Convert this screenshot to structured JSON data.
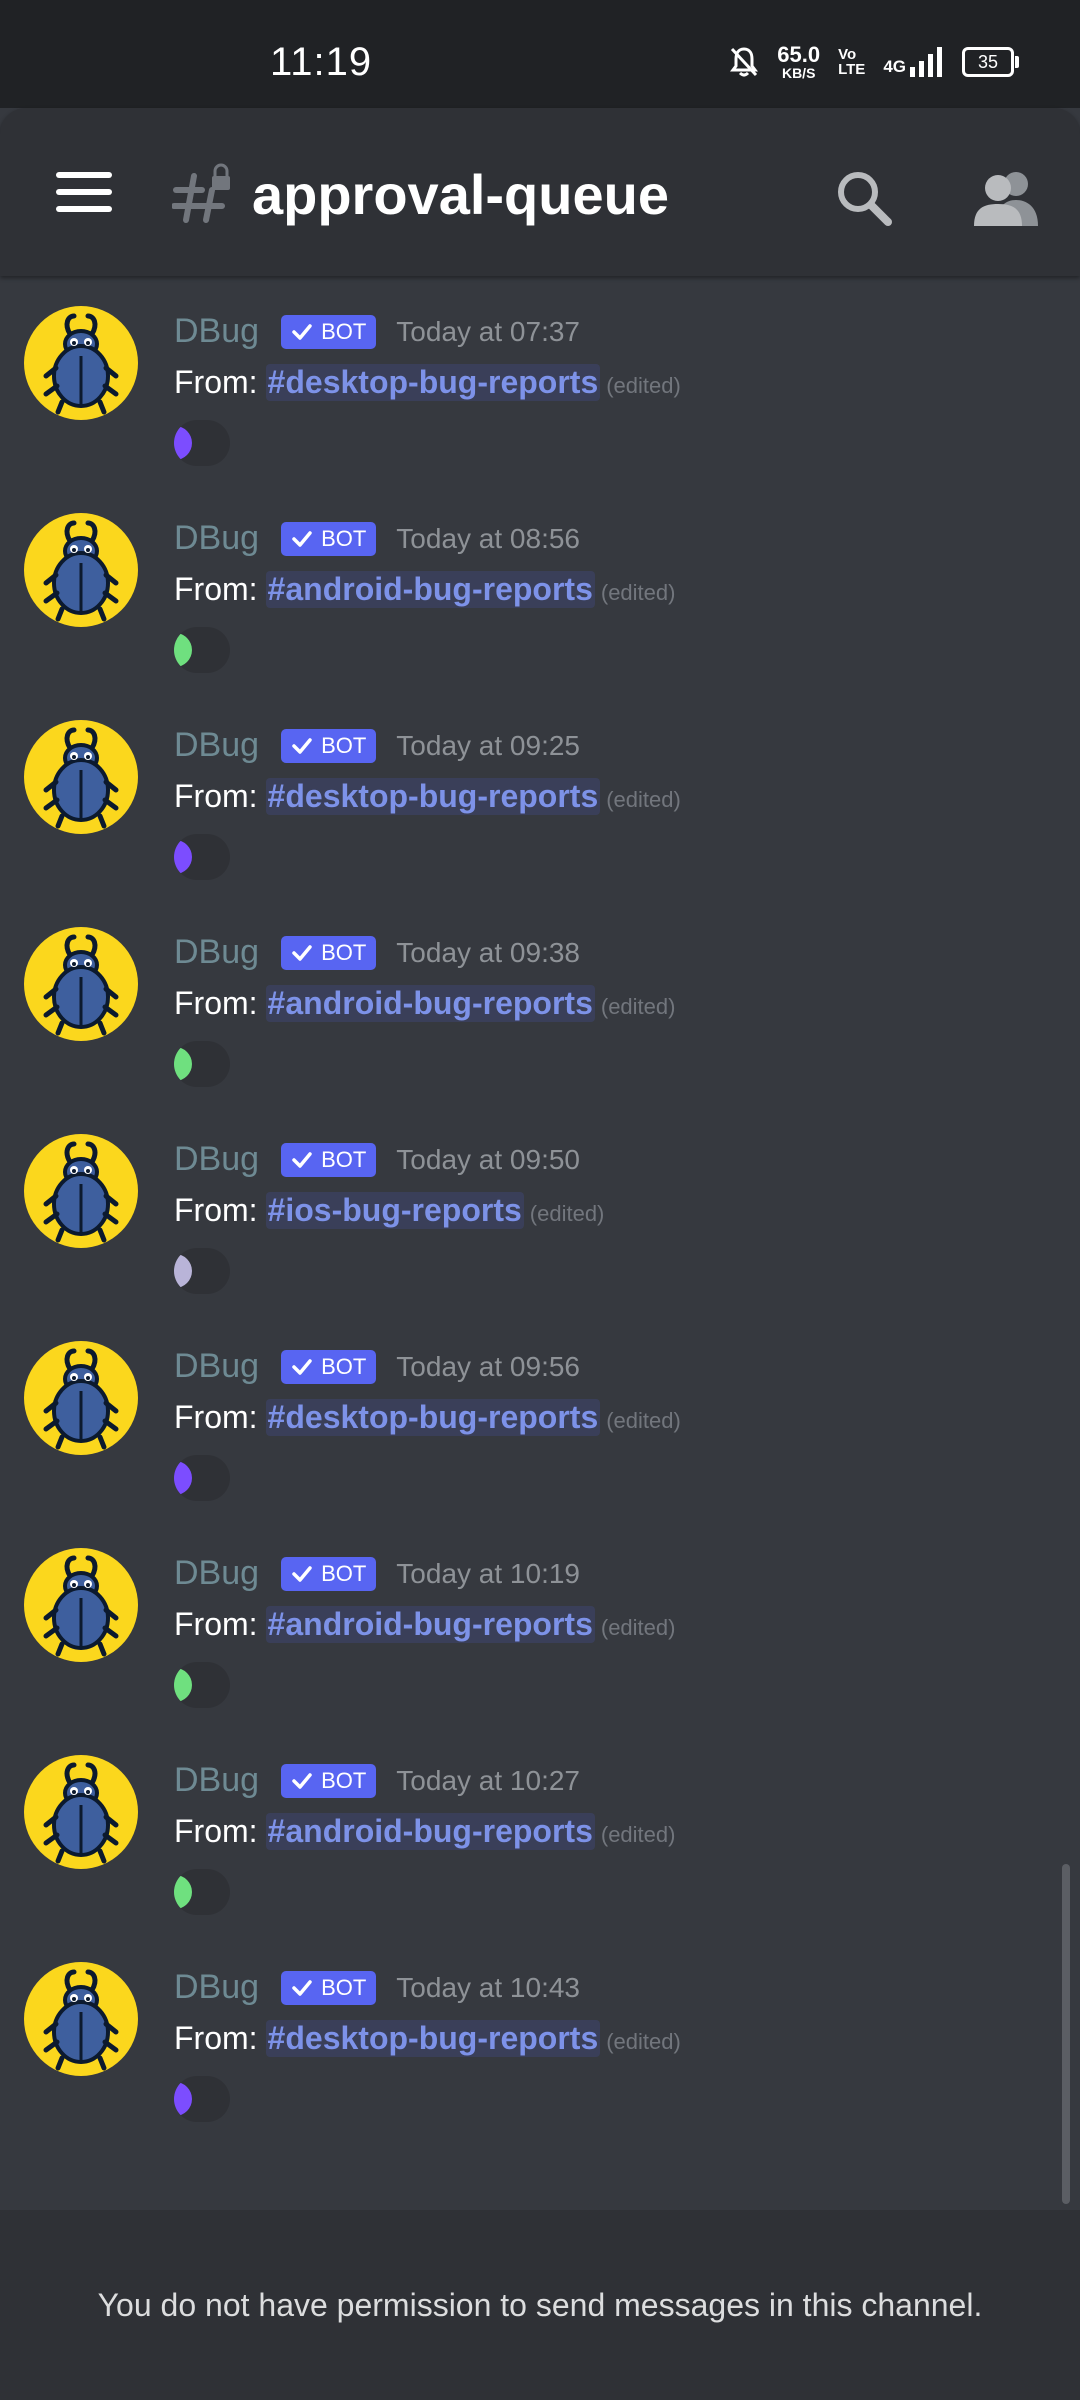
{
  "status_bar": {
    "time": "11:19",
    "net_speed_value": "65.0",
    "net_speed_unit": "KB/S",
    "volte_top": "Vo",
    "volte_bottom": "LTE",
    "network": "4G",
    "battery": "35"
  },
  "header": {
    "channel_name": "approval-queue"
  },
  "colors": {
    "avatar_bg": "#fbd71d",
    "mention": "#7d92e8",
    "bot_badge": "#5865f2",
    "background": "#36393f"
  },
  "messages": [
    {
      "username": "DBug",
      "badge": "BOT",
      "timestamp": "Today at 07:37",
      "from_label": "From:",
      "channel": "#desktop-bug-reports",
      "edited": "(edited)",
      "reaction_color": "#7c4dff"
    },
    {
      "username": "DBug",
      "badge": "BOT",
      "timestamp": "Today at 08:56",
      "from_label": "From:",
      "channel": "#android-bug-reports",
      "edited": "(edited)",
      "reaction_color": "#6fe07f"
    },
    {
      "username": "DBug",
      "badge": "BOT",
      "timestamp": "Today at 09:25",
      "from_label": "From:",
      "channel": "#desktop-bug-reports",
      "edited": "(edited)",
      "reaction_color": "#7c4dff"
    },
    {
      "username": "DBug",
      "badge": "BOT",
      "timestamp": "Today at 09:38",
      "from_label": "From:",
      "channel": "#android-bug-reports",
      "edited": "(edited)",
      "reaction_color": "#6fe07f"
    },
    {
      "username": "DBug",
      "badge": "BOT",
      "timestamp": "Today at 09:50",
      "from_label": "From:",
      "channel": "#ios-bug-reports",
      "edited": "(edited)",
      "reaction_color": "#b9b4d8"
    },
    {
      "username": "DBug",
      "badge": "BOT",
      "timestamp": "Today at 09:56",
      "from_label": "From:",
      "channel": "#desktop-bug-reports",
      "edited": "(edited)",
      "reaction_color": "#7c4dff"
    },
    {
      "username": "DBug",
      "badge": "BOT",
      "timestamp": "Today at 10:19",
      "from_label": "From:",
      "channel": "#android-bug-reports",
      "edited": "(edited)",
      "reaction_color": "#6fe07f"
    },
    {
      "username": "DBug",
      "badge": "BOT",
      "timestamp": "Today at 10:27",
      "from_label": "From:",
      "channel": "#android-bug-reports",
      "edited": "(edited)",
      "reaction_color": "#6fe07f"
    },
    {
      "username": "DBug",
      "badge": "BOT",
      "timestamp": "Today at 10:43",
      "from_label": "From:",
      "channel": "#desktop-bug-reports",
      "edited": "(edited)",
      "reaction_color": "#7c4dff"
    }
  ],
  "footer": {
    "notice": "You do not have permission to send messages in this channel."
  }
}
